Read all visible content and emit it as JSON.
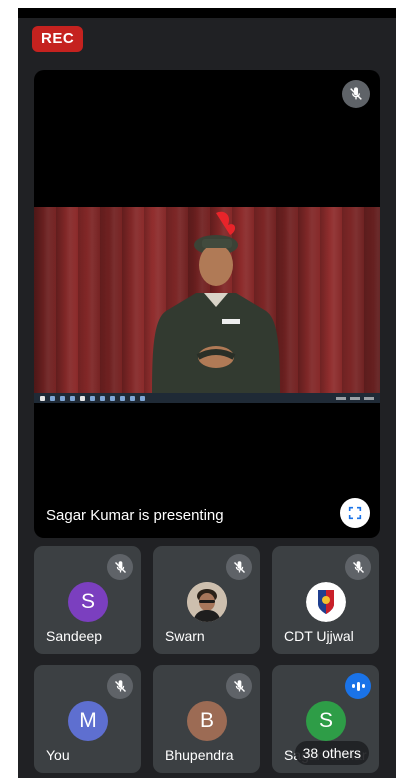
{
  "status": {
    "rec_label": "REC"
  },
  "presenter": {
    "label": "Sagar Kumar is presenting",
    "mic_icon": "mic-off-icon",
    "fullscreen_icon": "fullscreen-icon"
  },
  "participants": [
    {
      "name": "Sandeep",
      "initial": "S",
      "avatar_color": "#7b3fbf",
      "avatar_type": "initial",
      "mic": "muted"
    },
    {
      "name": "Swarn",
      "initial": "",
      "avatar_color": "#6b4f3a",
      "avatar_type": "photo",
      "mic": "muted"
    },
    {
      "name": "CDT Ujjwal",
      "initial": "",
      "avatar_color": "#ffffff",
      "avatar_type": "logo",
      "mic": "muted"
    },
    {
      "name": "You",
      "initial": "M",
      "avatar_color": "#5e6fd0",
      "avatar_type": "initial",
      "mic": "muted"
    },
    {
      "name": "Bhupendra",
      "initial": "B",
      "avatar_color": "#9c6b54",
      "avatar_type": "initial",
      "mic": "muted"
    },
    {
      "name": "Sagar Kumar",
      "initial": "S",
      "avatar_color": "#2e9d47",
      "avatar_type": "initial",
      "mic": "speaking"
    }
  ],
  "others": {
    "label": "38 others"
  },
  "colors": {
    "rec": "#c5221f",
    "tile": "#3c4043",
    "background": "#202124",
    "speaking": "#1a73e8"
  }
}
